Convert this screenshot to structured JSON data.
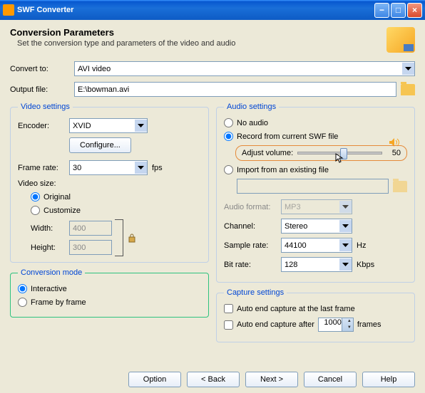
{
  "window": {
    "title": "SWF Converter"
  },
  "header": {
    "title": "Conversion Parameters",
    "subtitle": "Set the conversion type and parameters of the video and audio"
  },
  "convert": {
    "label": "Convert to:",
    "value": "AVI video"
  },
  "output": {
    "label": "Output file:",
    "value": "E:\\bowman.avi"
  },
  "video": {
    "legend": "Video settings",
    "encoder_label": "Encoder:",
    "encoder_value": "XVID",
    "configure": "Configure...",
    "framerate_label": "Frame rate:",
    "framerate_value": "30",
    "fps": "fps",
    "size_label": "Video size:",
    "original": "Original",
    "customize": "Customize",
    "width_label": "Width:",
    "width_value": "400",
    "height_label": "Height:",
    "height_value": "300"
  },
  "mode": {
    "legend": "Conversion mode",
    "interactive": "Interactive",
    "frame": "Frame by frame"
  },
  "audio": {
    "legend": "Audio settings",
    "no_audio": "No audio",
    "record": "Record from current SWF file",
    "adjust": "Adjust volume:",
    "volume": "50",
    "import": "Import from an existing file",
    "format_label": "Audio format:",
    "format_value": "MP3",
    "channel_label": "Channel:",
    "channel_value": "Stereo",
    "sample_label": "Sample rate:",
    "sample_value": "44100",
    "hz": "Hz",
    "bitrate_label": "Bit rate:",
    "bitrate_value": "128",
    "kbps": "Kbps"
  },
  "capture": {
    "legend": "Capture settings",
    "auto_end_last": "Auto end capture at the last frame",
    "auto_end_after": "Auto end capture after",
    "frames_value": "1000",
    "frames": "frames"
  },
  "buttons": {
    "option": "Option",
    "back": "< Back",
    "next": "Next >",
    "cancel": "Cancel",
    "help": "Help"
  }
}
